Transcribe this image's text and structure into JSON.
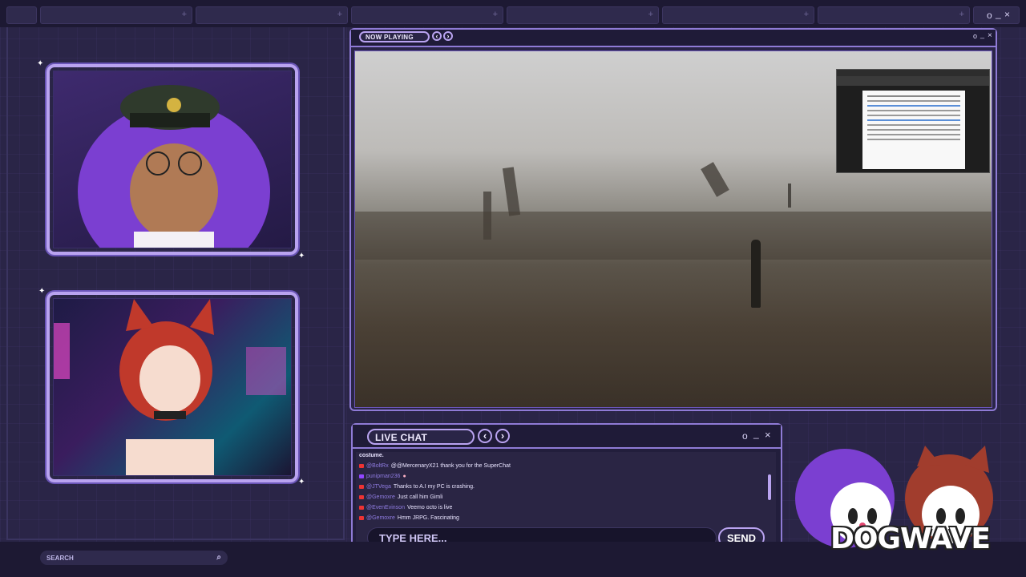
{
  "window": {
    "minimize_glyph": "o",
    "dash_glyph": "_",
    "close_glyph": "×"
  },
  "top_tabs": [
    "+",
    "+",
    "+",
    "+",
    "+",
    "+"
  ],
  "now_playing": {
    "label": "NOW PLAYING",
    "prev_glyph": "‹",
    "next_glyph": "›"
  },
  "live_chat": {
    "label": "LIVE CHAT",
    "prev_glyph": "‹",
    "next_glyph": "›",
    "messages": [
      {
        "user": "",
        "text": "costume."
      },
      {
        "user": "@BoltRx",
        "text": "@@MercenaryX21 thank you for the SuperChat"
      },
      {
        "user": "punipman236",
        "text": ""
      },
      {
        "user": "@JTVega",
        "text": "Thanks to A.I my PC is crashing."
      },
      {
        "user": "@Gemoxre",
        "text": "Just call him Gimli"
      },
      {
        "user": "@EvenEvinson",
        "text": "Veemo octo is live"
      },
      {
        "user": "@Gemoxre",
        "text": "Hmm JRPG. Fascinating"
      }
    ],
    "input_placeholder": "TYPE HERE...",
    "send_label": "SEND"
  },
  "search": {
    "label": "SEARCH"
  },
  "brand": {
    "logo_text": "DOGWAVE"
  },
  "colors": {
    "accent": "#b9a3f0",
    "background": "#2a2547",
    "bar": "#1d1933",
    "username": "#8f7be0"
  }
}
